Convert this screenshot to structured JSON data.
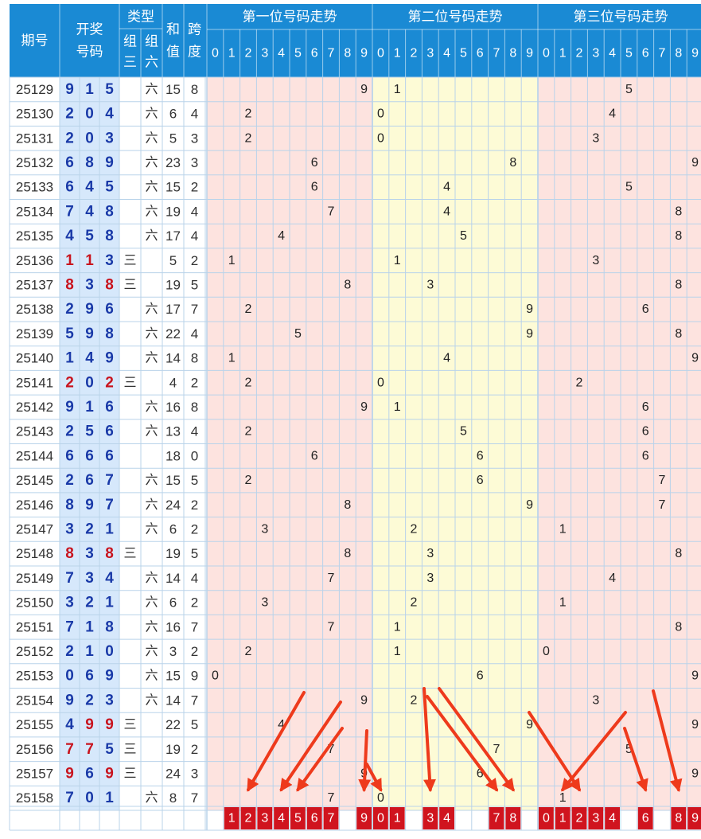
{
  "header": {
    "period_label": "期号",
    "draw_label_1": "开奖",
    "draw_label_2": "号码",
    "type_label": "类型",
    "type_z3_1": "组",
    "type_z3_2": "三",
    "type_z6_1": "组",
    "type_z6_2": "六",
    "sum_label_1": "和",
    "sum_label_2": "值",
    "span_label_1": "跨",
    "span_label_2": "度",
    "pos1_title": "第一位号码走势",
    "pos2_title": "第二位号码走势",
    "pos3_title": "第三位号码走势",
    "digits": [
      "0",
      "1",
      "2",
      "3",
      "4",
      "5",
      "6",
      "7",
      "8",
      "9"
    ]
  },
  "type_z3_text": "三",
  "type_z6_text": "六",
  "colors": {
    "header_bg": "#1a8ad4",
    "header_text": "#ffffff",
    "number_blue": "#1a3aa8",
    "number_red": "#c8141e",
    "number_col_bg": "#d6e8fb",
    "pos_pink_bg": "#fde3df",
    "pos_yellow_bg": "#fdfbd6",
    "grid_line": "#b9d3ea",
    "bottom_cell_bg": "#d0141e",
    "arrow": "#ee3a1c"
  },
  "chart_data": {
    "type": "table",
    "columns": [
      "期号",
      "开奖号码",
      "组三",
      "组六",
      "和值",
      "跨度",
      "第一位",
      "第二位",
      "第三位"
    ],
    "rows": [
      {
        "period": "25129",
        "digits": [
          9,
          1,
          5
        ],
        "z3": false,
        "z6": true,
        "sum": 15,
        "span": 8
      },
      {
        "period": "25130",
        "digits": [
          2,
          0,
          4
        ],
        "z3": false,
        "z6": true,
        "sum": 6,
        "span": 4
      },
      {
        "period": "25131",
        "digits": [
          2,
          0,
          3
        ],
        "z3": false,
        "z6": true,
        "sum": 5,
        "span": 3
      },
      {
        "period": "25132",
        "digits": [
          6,
          8,
          9
        ],
        "z3": false,
        "z6": true,
        "sum": 23,
        "span": 3
      },
      {
        "period": "25133",
        "digits": [
          6,
          4,
          5
        ],
        "z3": false,
        "z6": true,
        "sum": 15,
        "span": 2
      },
      {
        "period": "25134",
        "digits": [
          7,
          4,
          8
        ],
        "z3": false,
        "z6": true,
        "sum": 19,
        "span": 4
      },
      {
        "period": "25135",
        "digits": [
          4,
          5,
          8
        ],
        "z3": false,
        "z6": true,
        "sum": 17,
        "span": 4
      },
      {
        "period": "25136",
        "digits": [
          1,
          1,
          3
        ],
        "z3": true,
        "z6": false,
        "sum": 5,
        "span": 2
      },
      {
        "period": "25137",
        "digits": [
          8,
          3,
          8
        ],
        "z3": true,
        "z6": false,
        "sum": 19,
        "span": 5
      },
      {
        "period": "25138",
        "digits": [
          2,
          9,
          6
        ],
        "z3": false,
        "z6": true,
        "sum": 17,
        "span": 7
      },
      {
        "period": "25139",
        "digits": [
          5,
          9,
          8
        ],
        "z3": false,
        "z6": true,
        "sum": 22,
        "span": 4
      },
      {
        "period": "25140",
        "digits": [
          1,
          4,
          9
        ],
        "z3": false,
        "z6": true,
        "sum": 14,
        "span": 8
      },
      {
        "period": "25141",
        "digits": [
          2,
          0,
          2
        ],
        "z3": true,
        "z6": false,
        "sum": 4,
        "span": 2
      },
      {
        "period": "25142",
        "digits": [
          9,
          1,
          6
        ],
        "z3": false,
        "z6": true,
        "sum": 16,
        "span": 8
      },
      {
        "period": "25143",
        "digits": [
          2,
          5,
          6
        ],
        "z3": false,
        "z6": true,
        "sum": 13,
        "span": 4
      },
      {
        "period": "25144",
        "digits": [
          6,
          6,
          6
        ],
        "z3": false,
        "z6": false,
        "sum": 18,
        "span": 0
      },
      {
        "period": "25145",
        "digits": [
          2,
          6,
          7
        ],
        "z3": false,
        "z6": true,
        "sum": 15,
        "span": 5
      },
      {
        "period": "25146",
        "digits": [
          8,
          9,
          7
        ],
        "z3": false,
        "z6": true,
        "sum": 24,
        "span": 2
      },
      {
        "period": "25147",
        "digits": [
          3,
          2,
          1
        ],
        "z3": false,
        "z6": true,
        "sum": 6,
        "span": 2
      },
      {
        "period": "25148",
        "digits": [
          8,
          3,
          8
        ],
        "z3": true,
        "z6": false,
        "sum": 19,
        "span": 5
      },
      {
        "period": "25149",
        "digits": [
          7,
          3,
          4
        ],
        "z3": false,
        "z6": true,
        "sum": 14,
        "span": 4
      },
      {
        "period": "25150",
        "digits": [
          3,
          2,
          1
        ],
        "z3": false,
        "z6": true,
        "sum": 6,
        "span": 2
      },
      {
        "period": "25151",
        "digits": [
          7,
          1,
          8
        ],
        "z3": false,
        "z6": true,
        "sum": 16,
        "span": 7
      },
      {
        "period": "25152",
        "digits": [
          2,
          1,
          0
        ],
        "z3": false,
        "z6": true,
        "sum": 3,
        "span": 2
      },
      {
        "period": "25153",
        "digits": [
          0,
          6,
          9
        ],
        "z3": false,
        "z6": true,
        "sum": 15,
        "span": 9
      },
      {
        "period": "25154",
        "digits": [
          9,
          2,
          3
        ],
        "z3": false,
        "z6": true,
        "sum": 14,
        "span": 7
      },
      {
        "period": "25155",
        "digits": [
          4,
          9,
          9
        ],
        "z3": true,
        "z6": false,
        "sum": 22,
        "span": 5
      },
      {
        "period": "25156",
        "digits": [
          7,
          7,
          5
        ],
        "z3": true,
        "z6": false,
        "sum": 19,
        "span": 2
      },
      {
        "period": "25157",
        "digits": [
          9,
          6,
          9
        ],
        "z3": true,
        "z6": false,
        "sum": 24,
        "span": 3
      },
      {
        "period": "25158",
        "digits": [
          7,
          0,
          1
        ],
        "z3": false,
        "z6": true,
        "sum": 8,
        "span": 7
      }
    ],
    "prediction_digits": {
      "pos1": [
        1,
        2,
        3,
        4,
        5,
        6,
        7,
        9
      ],
      "pos2": [
        0,
        1,
        3,
        4,
        7,
        8
      ],
      "pos3": [
        0,
        1,
        2,
        3,
        4,
        6,
        8,
        9
      ]
    },
    "arrow_targets": [
      {
        "pos": 1,
        "digit": 2
      },
      {
        "pos": 1,
        "digit": 4
      },
      {
        "pos": 1,
        "digit": 5
      },
      {
        "pos": 1,
        "digit": 9
      },
      {
        "pos": 2,
        "digit": 0
      },
      {
        "pos": 2,
        "digit": 3
      },
      {
        "pos": 2,
        "digit": 7
      },
      {
        "pos": 2,
        "digit": 8
      },
      {
        "pos": 3,
        "digit": 1
      },
      {
        "pos": 3,
        "digit": 2
      },
      {
        "pos": 3,
        "digit": 6
      },
      {
        "pos": 3,
        "digit": 8
      }
    ]
  }
}
